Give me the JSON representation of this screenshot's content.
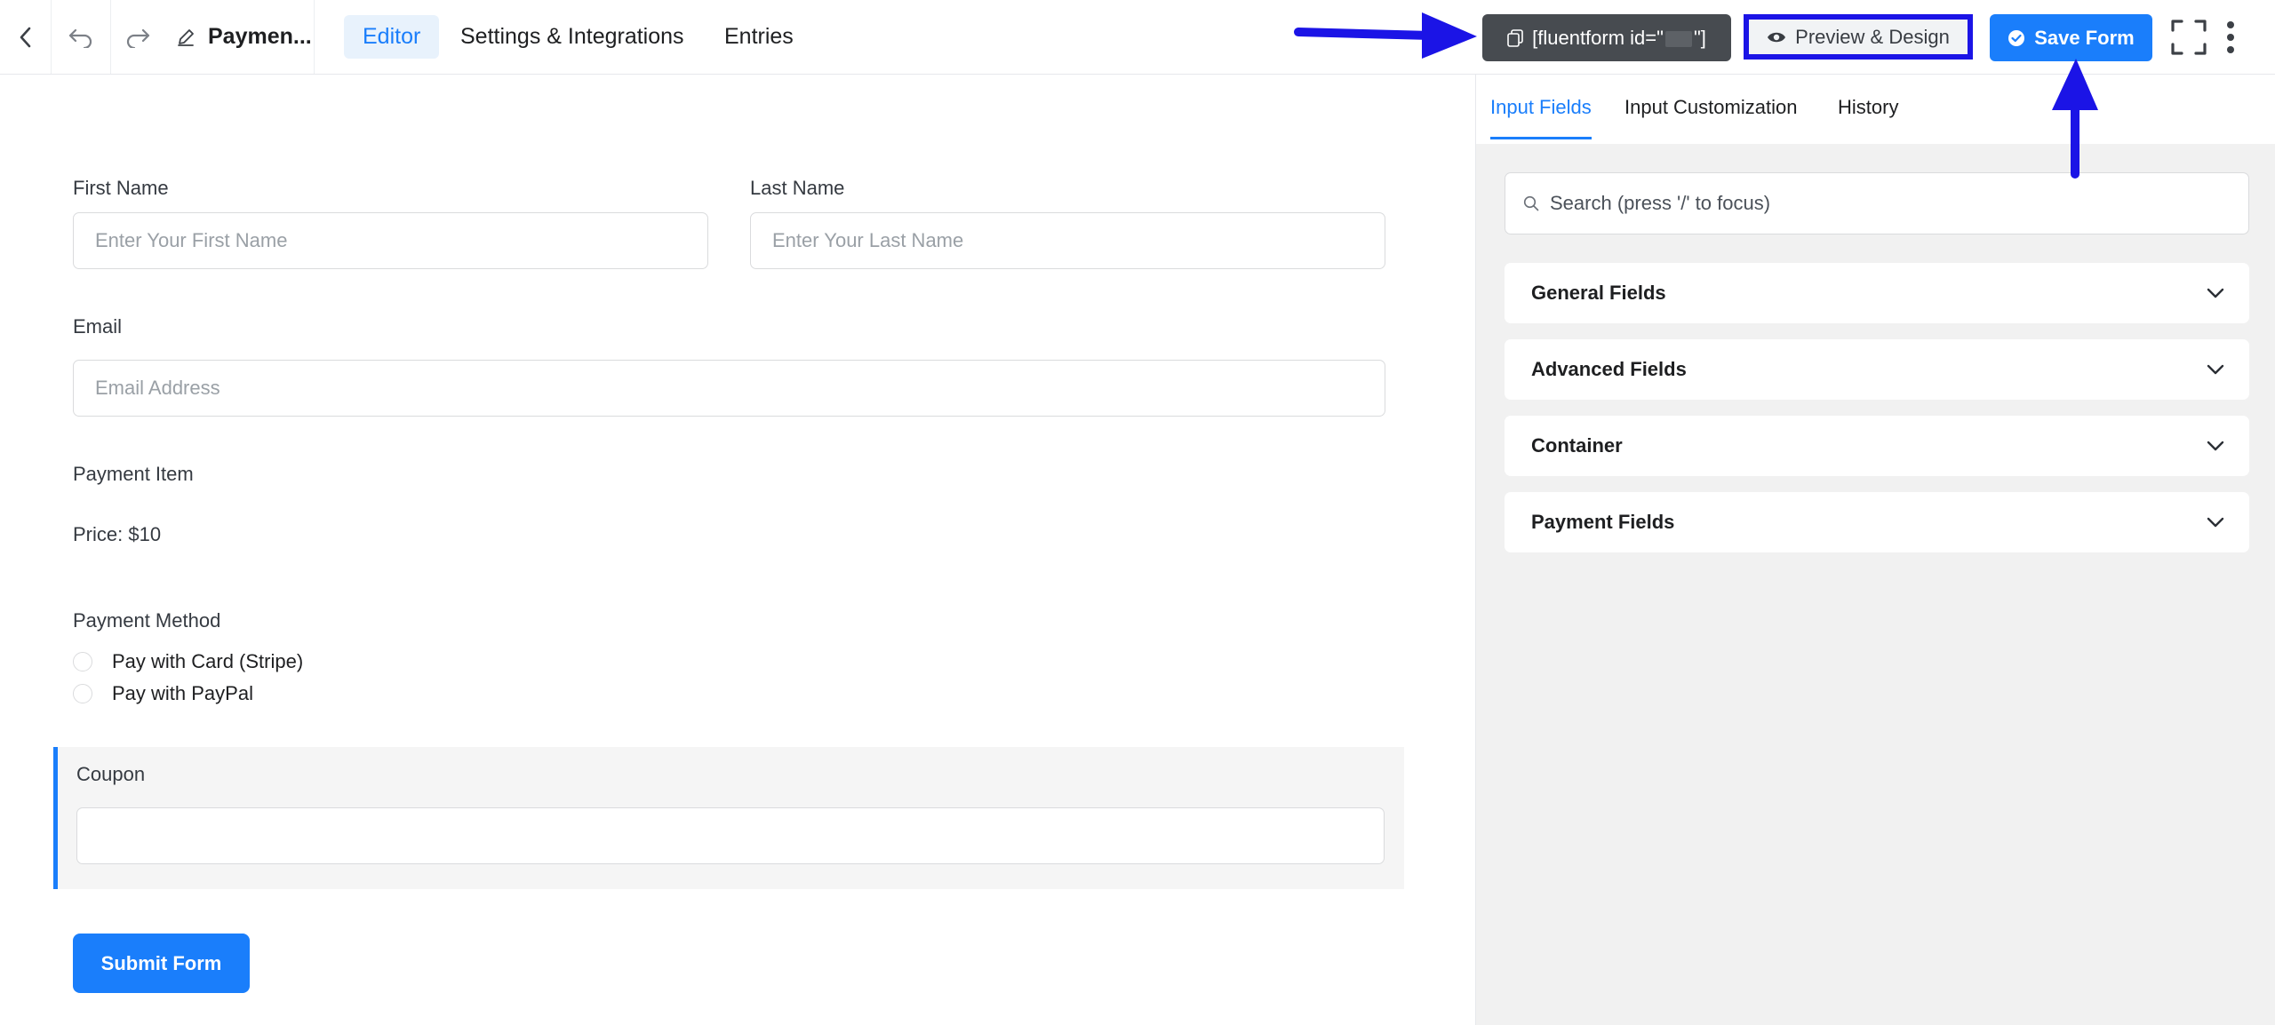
{
  "toolbar": {
    "form_title": "Paymen...",
    "tabs": [
      {
        "label": "Editor",
        "active": true
      },
      {
        "label": "Settings & Integrations",
        "active": false
      },
      {
        "label": "Entries",
        "active": false
      }
    ],
    "shortcode_prefix": "[fluentform id=\"",
    "shortcode_suffix": "\"]",
    "preview_label": "Preview & Design",
    "save_label": "Save Form"
  },
  "form": {
    "first_name": {
      "label": "First Name",
      "placeholder": "Enter Your First Name"
    },
    "last_name": {
      "label": "Last Name",
      "placeholder": "Enter Your Last Name"
    },
    "email": {
      "label": "Email",
      "placeholder": "Email Address"
    },
    "payment_item": {
      "label": "Payment Item",
      "price_text": "Price: $10"
    },
    "payment_method": {
      "label": "Payment Method",
      "options": [
        "Pay with Card (Stripe)",
        "Pay with PayPal"
      ]
    },
    "coupon": {
      "label": "Coupon",
      "value": ""
    },
    "submit_label": "Submit Form"
  },
  "sidebar": {
    "tabs": [
      {
        "label": "Input Fields",
        "active": true
      },
      {
        "label": "Input Customization",
        "active": false
      },
      {
        "label": "History",
        "active": false
      }
    ],
    "search_placeholder": "Search (press '/' to focus)",
    "groups": [
      "General Fields",
      "Advanced Fields",
      "Container",
      "Payment Fields"
    ]
  },
  "colors": {
    "accent": "#1a7efb",
    "shortcode_bg": "#474b50",
    "annotation": "#1b14e6",
    "sidebar_bg": "#f1f1f1"
  }
}
